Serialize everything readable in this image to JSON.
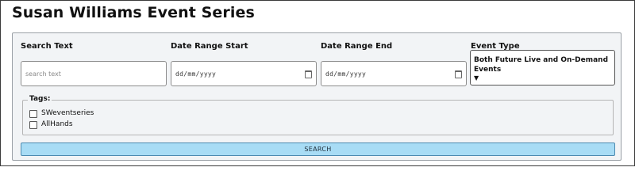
{
  "page": {
    "title": "Susan Williams Event Series"
  },
  "search": {
    "label": "Search Text",
    "placeholder": "search text",
    "value": ""
  },
  "date_start": {
    "label": "Date Range Start",
    "placeholder": "dd/mm/yyyy"
  },
  "date_end": {
    "label": "Date Range End",
    "placeholder": "dd/mm/yyyy"
  },
  "event_type": {
    "label": "Event Type",
    "selected": "Both Future Live and On-Demand Events",
    "arrow": "▼"
  },
  "tags": {
    "legend": "Tags:",
    "items": [
      {
        "label": "SWeventseries",
        "checked": false
      },
      {
        "label": "AllHands",
        "checked": false
      }
    ]
  },
  "search_button": {
    "label": "SEARCH"
  },
  "colors": {
    "button_bg": "#a8dcf5",
    "panel_bg": "#f2f4f6"
  }
}
